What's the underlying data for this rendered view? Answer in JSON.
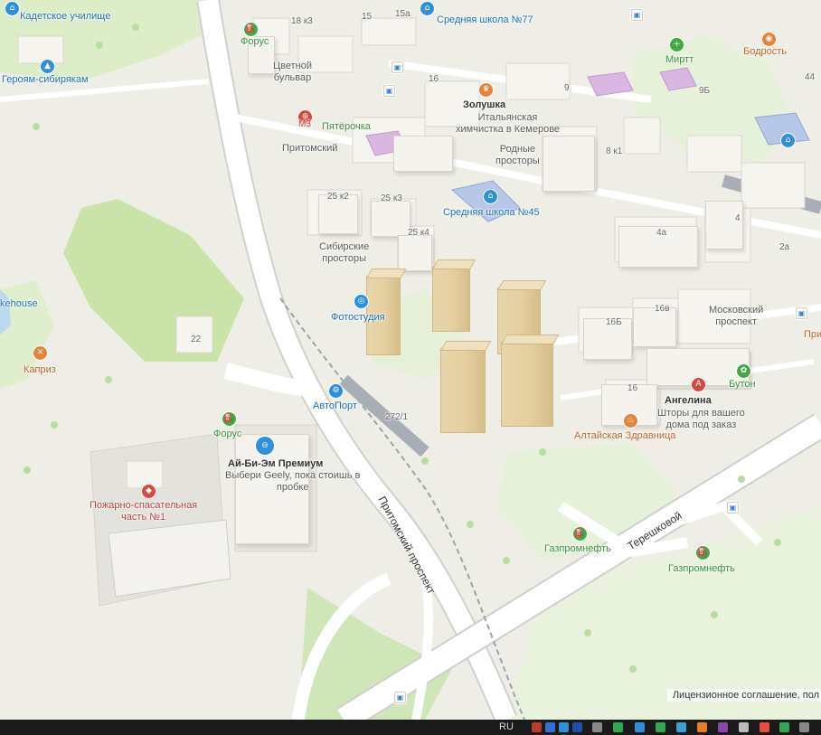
{
  "map": {
    "labels": {
      "kadet": "Кадетское училище",
      "heroes": "Героям-сибирякам",
      "forus_top": "Форус",
      "tsvetnoy": "Цветной\nбульвар",
      "k18": "18 к3",
      "n15": "15",
      "n15a": "15а",
      "school77": "Средняя школа №77",
      "mirt": "Миртт",
      "bodrost": "Бодрость",
      "n44": "44",
      "n16top": "16",
      "zolushka": "Золушка",
      "zolushka_sub": "Итальянская\nхимчистка в Кемерове",
      "m3": "М3",
      "pyaterochka": "Пятёрочка",
      "pritomsky": "Притомский",
      "rodnye": "Родные\nпросторы",
      "n9": "9",
      "n9b": "9Б",
      "n8k1": "8 к1",
      "n25k2": "25 к2",
      "n25k3": "25 к3",
      "school45": "Средняя школа №45",
      "n25k4": "25 к4",
      "n4": "4",
      "n4a": "4а",
      "n2a": "2а",
      "sibirskie": "Сибирские\nпросторы",
      "fotostudiya": "Фотостудия",
      "n16b": "16Б",
      "n16v": "16в",
      "moskovsky": "Московский\nпроспект",
      "pri": "При",
      "kehouse": "kehouse",
      "kapriz": "Каприз",
      "n22": "22",
      "avtoport": "АвтоПорт",
      "n272": "272/1",
      "n16": "16",
      "angelina": "Ангелина",
      "angelina_sub": "Шторы для вашего\nдома под заказ",
      "buton": "Бутон",
      "altayskaya": "Алтайская Здравница",
      "forus_mid": "Форус",
      "aibiem": "Ай-Би-Эм Премиум",
      "aibiem_sub": "Выбери Geely, пока стоишь в\nпробке",
      "pozharno": "Пожарно-спасательная\nчасть №1",
      "tereshkovoy": "Терешковой",
      "pritomsky_pr": "Притомский проспект",
      "gazprom1": "Газпромнефть",
      "gazprom2": "Газпромнефть"
    },
    "license": "Лицензионное соглашение, пол"
  },
  "taskbar": {
    "lang": "RU"
  },
  "colors": {
    "road": "#ffffff",
    "park": "#dfeecd",
    "water": "#bcd9ef",
    "accent": "#2f8fd8"
  }
}
